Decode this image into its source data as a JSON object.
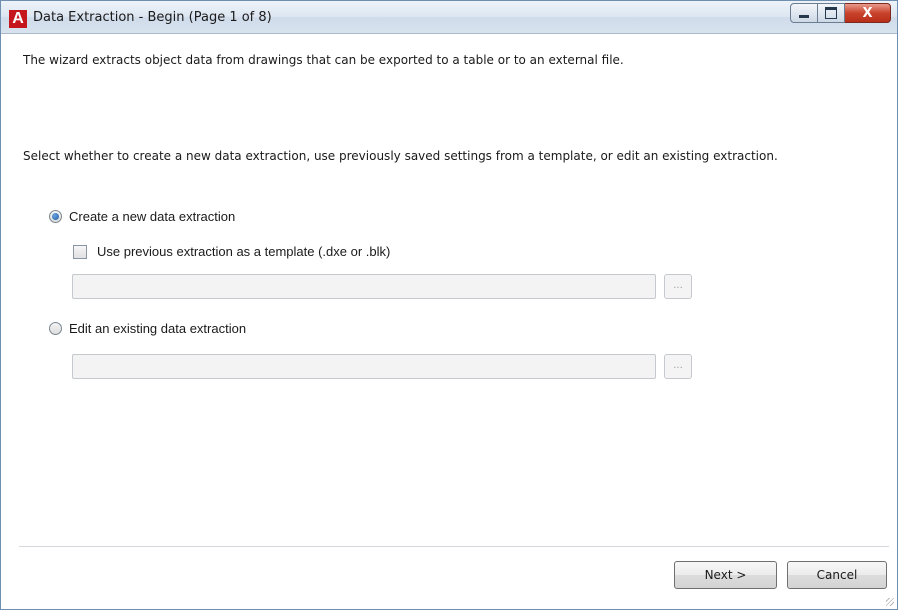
{
  "window": {
    "title": "Data Extraction - Begin (Page 1 of 8)",
    "app_icon_letter": "A",
    "controls": {
      "minimize": "",
      "maximize": "",
      "close": "X"
    }
  },
  "content": {
    "intro": "The wizard extracts object data from drawings that can be exported to a table or to an external file.",
    "instruction": "Select whether to create a new data extraction, use previously saved settings from a template, or edit an existing extraction.",
    "options": {
      "create_new": {
        "label": "Create a new data extraction",
        "selected": true
      },
      "use_template": {
        "label": "Use previous extraction as a template (.dxe or .blk)",
        "checked": false,
        "path_value": "",
        "browse_label": "..."
      },
      "edit_existing": {
        "label": "Edit an existing data extraction",
        "selected": false,
        "path_value": "",
        "browse_label": "..."
      }
    }
  },
  "footer": {
    "next_label": "Next >",
    "cancel_label": "Cancel"
  },
  "colors": {
    "accent": "#1e5ea8",
    "app_icon": "#c4161c",
    "close_button": "#c9432c"
  }
}
